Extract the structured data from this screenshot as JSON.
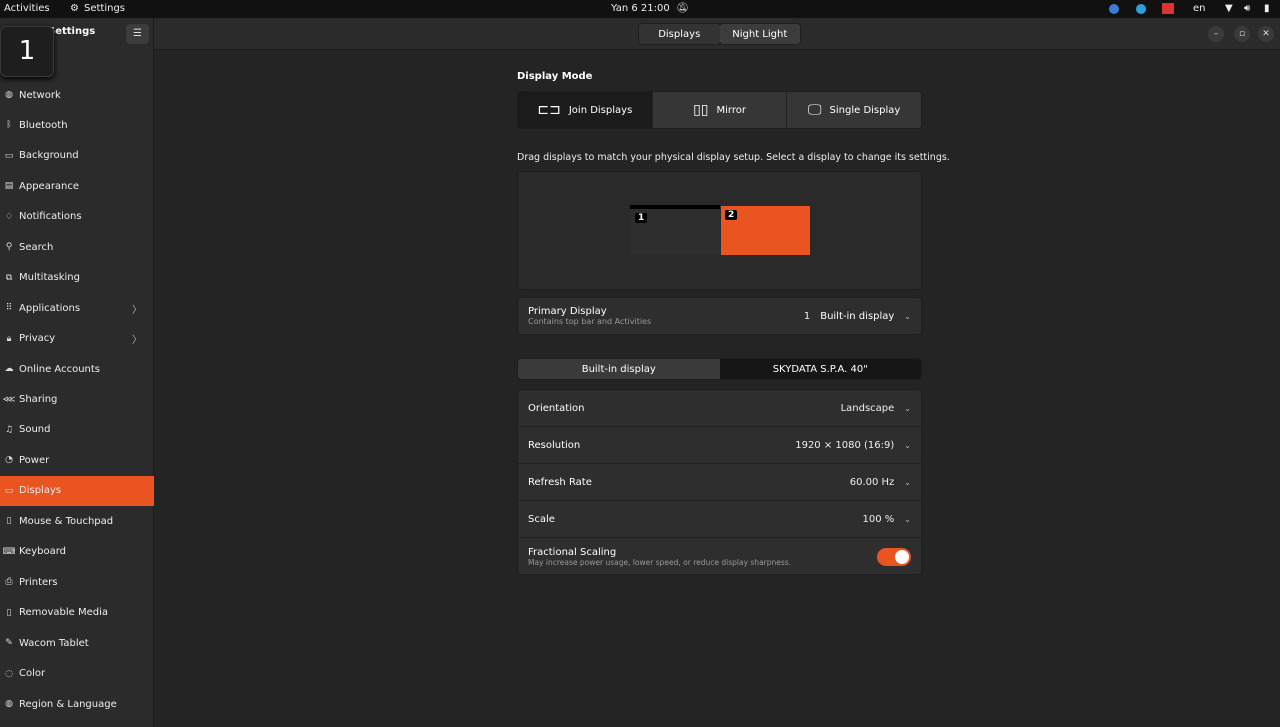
{
  "topbar": {
    "activities": "Activities",
    "app": "Settings",
    "clock": "Yan 6  21:00",
    "lang": "en"
  },
  "window": {
    "title": "Settings",
    "badge": "1",
    "tabs": [
      "Displays",
      "Night Light"
    ]
  },
  "sidebar": {
    "items": [
      {
        "label": "Network",
        "icon": "globe-icon",
        "glyph": "◍"
      },
      {
        "label": "Bluetooth",
        "icon": "bluetooth-icon",
        "glyph": "ᛒ"
      },
      {
        "label": "Background",
        "icon": "background-icon",
        "glyph": "▭"
      },
      {
        "label": "Appearance",
        "icon": "appearance-icon",
        "glyph": "▤"
      },
      {
        "label": "Notifications",
        "icon": "bell-icon",
        "glyph": "♢"
      },
      {
        "label": "Search",
        "icon": "search-icon",
        "glyph": "⚲"
      },
      {
        "label": "Multitasking",
        "icon": "multitasking-icon",
        "glyph": "⧉"
      },
      {
        "label": "Applications",
        "icon": "grid-icon",
        "glyph": "⠿",
        "chevron": true
      },
      {
        "label": "Privacy",
        "icon": "lock-icon",
        "glyph": "🔒︎",
        "chevron": true
      },
      {
        "label": "Online Accounts",
        "icon": "cloud-icon",
        "glyph": "☁"
      },
      {
        "label": "Sharing",
        "icon": "share-icon",
        "glyph": "⋘"
      },
      {
        "label": "Sound",
        "icon": "music-icon",
        "glyph": "♫"
      },
      {
        "label": "Power",
        "icon": "power-icon",
        "glyph": "◔"
      },
      {
        "label": "Displays",
        "icon": "display-icon",
        "glyph": "▭",
        "active": true
      },
      {
        "label": "Mouse & Touchpad",
        "icon": "mouse-icon",
        "glyph": "▯"
      },
      {
        "label": "Keyboard",
        "icon": "keyboard-icon",
        "glyph": "⌨"
      },
      {
        "label": "Printers",
        "icon": "printer-icon",
        "glyph": "⎙"
      },
      {
        "label": "Removable Media",
        "icon": "media-icon",
        "glyph": "▯"
      },
      {
        "label": "Wacom Tablet",
        "icon": "tablet-icon",
        "glyph": "✎"
      },
      {
        "label": "Color",
        "icon": "color-icon",
        "glyph": "◌"
      },
      {
        "label": "Region & Language",
        "icon": "region-icon",
        "glyph": "◍"
      }
    ]
  },
  "display_mode": {
    "title": "Display Mode",
    "options": [
      "Join Displays",
      "Mirror",
      "Single Display"
    ],
    "selected": "Join Displays"
  },
  "arrangement": {
    "hint": "Drag displays to match your physical display setup. Select a display to change its settings.",
    "monitors": [
      "1",
      "2"
    ],
    "selected": "2",
    "accent": "#e95420"
  },
  "primary": {
    "label": "Primary Display",
    "sub": "Contains top bar and Activities",
    "num": "1",
    "value": "Built-in display"
  },
  "display_tabs": [
    "Built-in display",
    "SKYDATA S.P.A. 40\""
  ],
  "settings": {
    "orientation": {
      "label": "Orientation",
      "value": "Landscape"
    },
    "resolution": {
      "label": "Resolution",
      "value": "1920 × 1080 (16:9)"
    },
    "refresh": {
      "label": "Refresh Rate",
      "value": "60.00 Hz"
    },
    "scale": {
      "label": "Scale",
      "value": "100 %"
    },
    "fractional": {
      "label": "Fractional Scaling",
      "sub": "May increase power usage, lower speed, or reduce display sharpness.",
      "enabled": true
    }
  }
}
